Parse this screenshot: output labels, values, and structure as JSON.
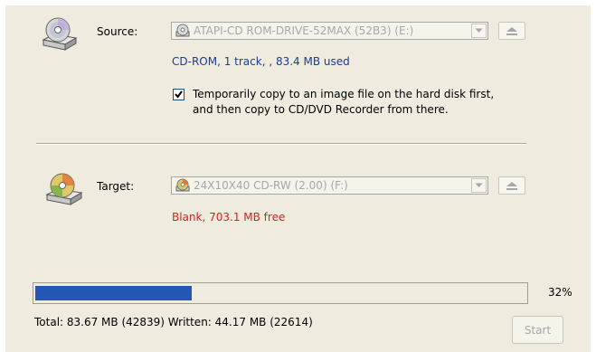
{
  "source": {
    "label": "Source:",
    "drive": "ATAPI-CD ROM-DRIVE-52MAX (52B3) (E:)",
    "info": "CD-ROM, 1 track, , 83.4 MB used"
  },
  "option": {
    "checked": true,
    "label_line1": "Temporarily copy to an image file on the hard disk first,",
    "label_line2": "and then copy to CD/DVD Recorder from there."
  },
  "target": {
    "label": "Target:",
    "drive": "24X10X40 CD-RW (2.00) (F:)",
    "info": "Blank, 703.1 MB free"
  },
  "progress": {
    "percent_text": "32%",
    "fraction": 0.32
  },
  "status": "Total: 83.67 MB (42839)  Written: 44.17 MB (22614)",
  "start_label": "Start",
  "colors": {
    "panel": "#efebde",
    "progress_fill": "#2456b4",
    "info_blue": "#1a3c9a",
    "info_red": "#d92020",
    "disabled_text": "#a7a6aa"
  },
  "icons": {
    "source": "cd-drive-icon",
    "target": "cd-recorder-icon",
    "eject": "eject-icon",
    "dropdown": "chevron-down-icon"
  }
}
